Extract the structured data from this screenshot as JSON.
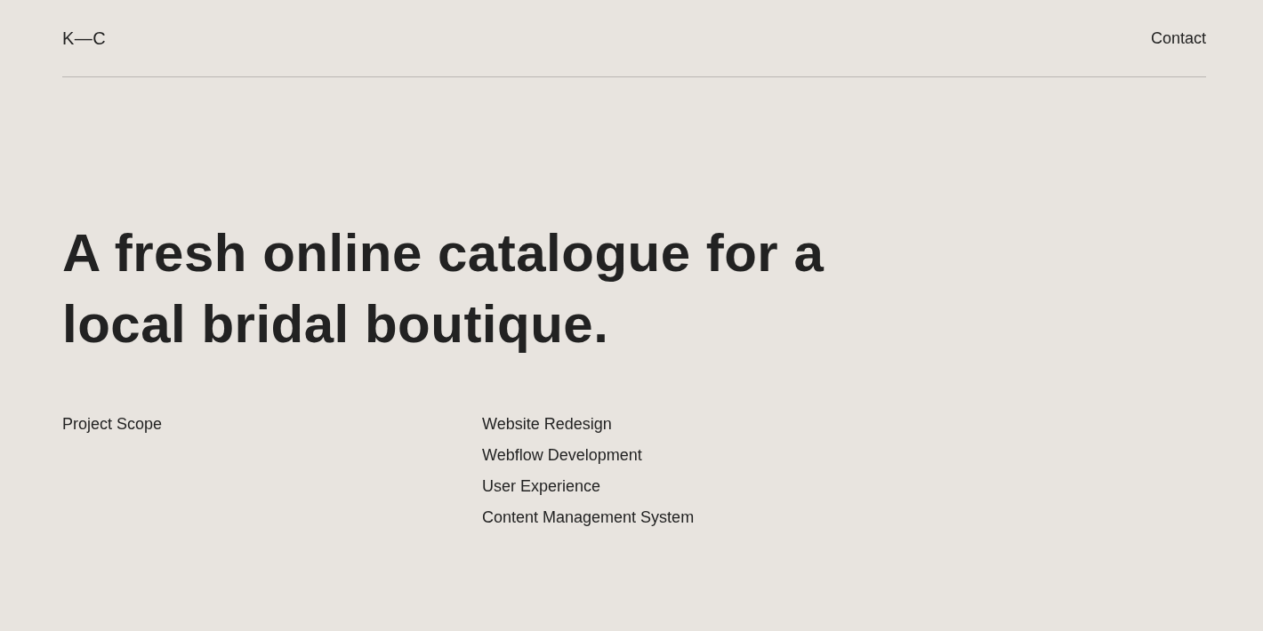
{
  "header": {
    "logo": "K—C",
    "nav_link": "Contact"
  },
  "headline": "A fresh online catalogue for a local bridal boutique.",
  "project_scope": {
    "label": "Project Scope",
    "items": [
      "Website Redesign",
      "Webflow Development",
      "User Experience",
      "Content Management System"
    ]
  }
}
